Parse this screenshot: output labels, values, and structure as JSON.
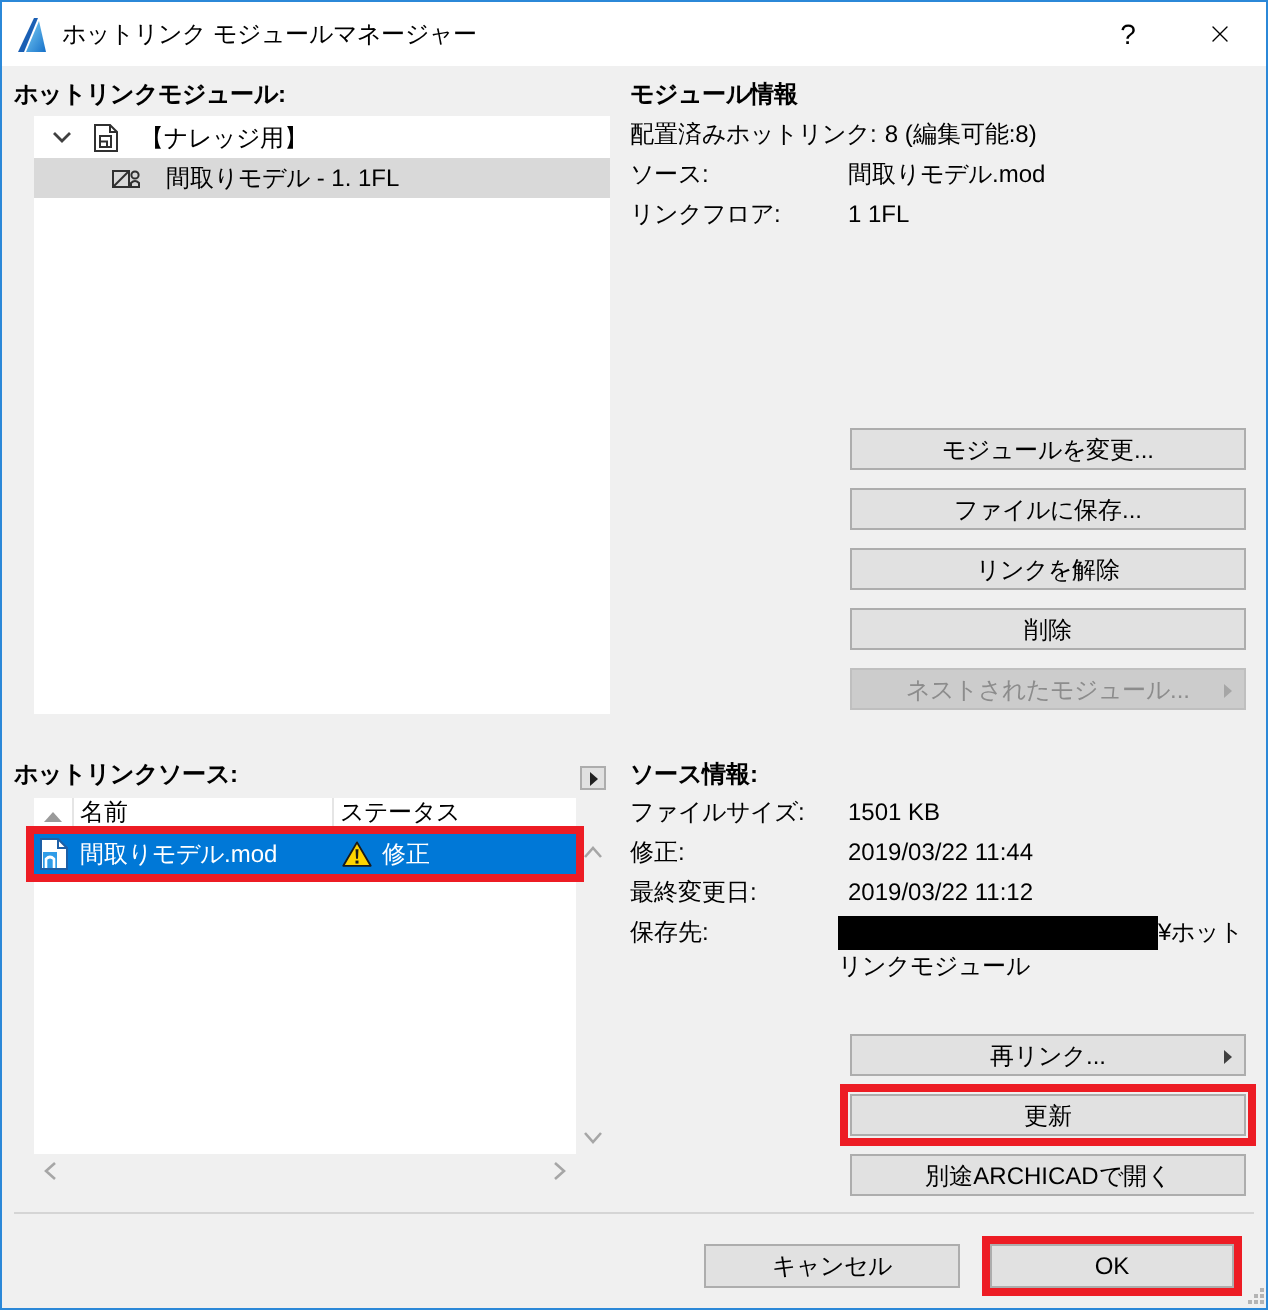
{
  "window": {
    "title": "ホットリンク モジュールマネージャー",
    "help_label": "?"
  },
  "module_panel": {
    "heading": "ホットリンクモジュール:",
    "tree": [
      {
        "label": "【ナレッジ用】",
        "expanded": true,
        "selected": false,
        "children": [
          {
            "label": "間取りモデル - 1. 1FL",
            "selected": true
          }
        ]
      }
    ]
  },
  "module_info": {
    "heading": "モジュール情報",
    "rows": [
      {
        "label": "配置済みホットリンク:",
        "value": "8 (編集可能:8)"
      },
      {
        "label": "ソース:",
        "value": "間取りモデル.mod"
      },
      {
        "label": "リンクフロア:",
        "value": "1 1FL"
      }
    ],
    "buttons": [
      {
        "label": "モジュールを変更...",
        "disabled": false,
        "submenu": false
      },
      {
        "label": "ファイルに保存...",
        "disabled": false,
        "submenu": false
      },
      {
        "label": "リンクを解除",
        "disabled": false,
        "submenu": false
      },
      {
        "label": "削除",
        "disabled": false,
        "submenu": false
      },
      {
        "label": "ネストされたモジュール...",
        "disabled": true,
        "submenu": true
      }
    ]
  },
  "source_panel": {
    "heading": "ホットリンクソース:",
    "columns": [
      "名前",
      "ステータス"
    ],
    "rows": [
      {
        "name": "間取りモデル.mod",
        "status": "修正",
        "selected": true,
        "highlighted": true
      }
    ]
  },
  "source_info": {
    "heading": "ソース情報:",
    "rows": [
      {
        "label": "ファイルサイズ:",
        "value": "1501 KB",
        "redacted": false
      },
      {
        "label": "修正:",
        "value": "2019/03/22 11:44",
        "redacted": false
      },
      {
        "label": "最終変更日:",
        "value": "2019/03/22 11:12",
        "redacted": false
      },
      {
        "label": "保存先:",
        "value": "¥ホットリンクモジュール",
        "redacted": true
      }
    ],
    "buttons": [
      {
        "label": "再リンク...",
        "submenu": true,
        "highlighted": false
      },
      {
        "label": "更新",
        "submenu": false,
        "highlighted": true
      },
      {
        "label": "別途ARCHICADで開く",
        "submenu": false,
        "highlighted": false
      }
    ]
  },
  "footer_buttons": [
    {
      "label": "キャンセル",
      "highlighted": false
    },
    {
      "label": "OK",
      "highlighted": true
    }
  ]
}
